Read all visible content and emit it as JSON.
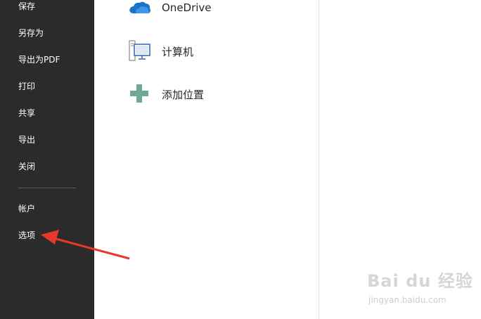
{
  "sidebar": {
    "items": [
      {
        "label": "保存"
      },
      {
        "label": "另存为"
      },
      {
        "label": "导出为PDF"
      },
      {
        "label": "打印"
      },
      {
        "label": "共享"
      },
      {
        "label": "导出"
      },
      {
        "label": "关闭"
      }
    ],
    "bottom_items": [
      {
        "label": "帐户"
      },
      {
        "label": "选项"
      }
    ]
  },
  "places": [
    {
      "label": "OneDrive",
      "icon": "onedrive-cloud-icon"
    },
    {
      "label": "计算机",
      "icon": "computer-icon"
    },
    {
      "label": "添加位置",
      "icon": "add-location-icon"
    }
  ],
  "colors": {
    "sidebar_bg": "#2b2b2b",
    "onedrive_blue": "#1a73c8",
    "add_green": "#6fa894",
    "annotation_red": "#e8372b"
  },
  "watermark": {
    "brand": "Bai du 经验",
    "url": "jingyan.baidu.com"
  }
}
